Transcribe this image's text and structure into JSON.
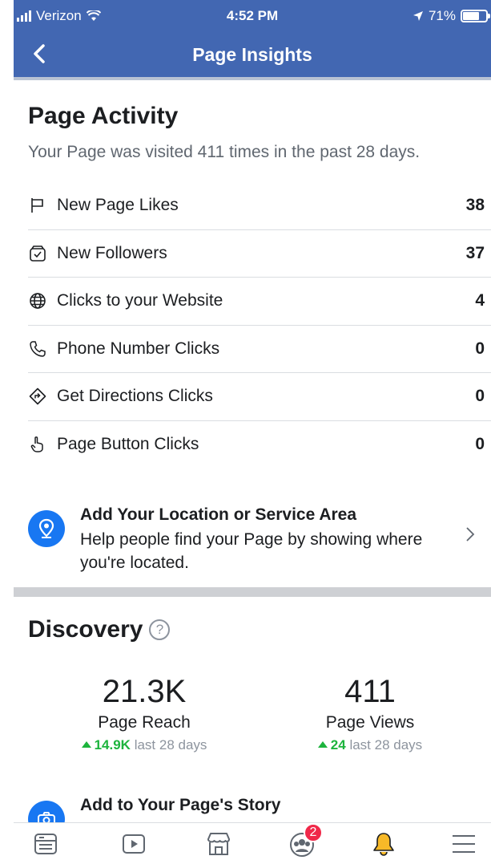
{
  "status_bar": {
    "carrier": "Verizon",
    "time": "4:52 PM",
    "battery": "71%",
    "battery_level": 0.71
  },
  "nav": {
    "title": "Page Insights",
    "back_icon": "chevron-left-icon"
  },
  "activity": {
    "title": "Page Activity",
    "subtitle": "Your Page was visited 411 times in the past 28 days.",
    "metrics": [
      {
        "label": "New Page Likes",
        "value": "38",
        "icon": "flag-icon"
      },
      {
        "label": "New Followers",
        "value": "37",
        "icon": "follow-inbox-icon"
      },
      {
        "label": "Clicks to your Website",
        "value": "4",
        "icon": "globe-icon"
      },
      {
        "label": "Phone Number Clicks",
        "value": "0",
        "icon": "phone-icon"
      },
      {
        "label": "Get Directions Clicks",
        "value": "0",
        "icon": "directions-icon"
      },
      {
        "label": "Page Button Clicks",
        "value": "0",
        "icon": "tap-finger-icon"
      }
    ]
  },
  "promo": {
    "title": "Add Your Location or Service Area",
    "description": "Help people find your Page by showing where you're located."
  },
  "discovery": {
    "title": "Discovery",
    "help": "?",
    "stats": [
      {
        "value": "21.3K",
        "label": "Page Reach",
        "delta": "14.9K",
        "period": "last 28 days"
      },
      {
        "value": "411",
        "label": "Page Views",
        "delta": "24",
        "period": "last 28 days"
      }
    ]
  },
  "story": {
    "title": "Add to Your Page's Story"
  },
  "tabbar": {
    "items": [
      "news-feed-icon",
      "watch-icon",
      "marketplace-icon",
      "groups-icon",
      "notifications-icon",
      "menu-icon"
    ],
    "groups_badge": "2"
  },
  "colors": {
    "brand": "#4267b2",
    "accent": "#1877f2",
    "positive": "#1db43d",
    "badge": "#f02849"
  }
}
